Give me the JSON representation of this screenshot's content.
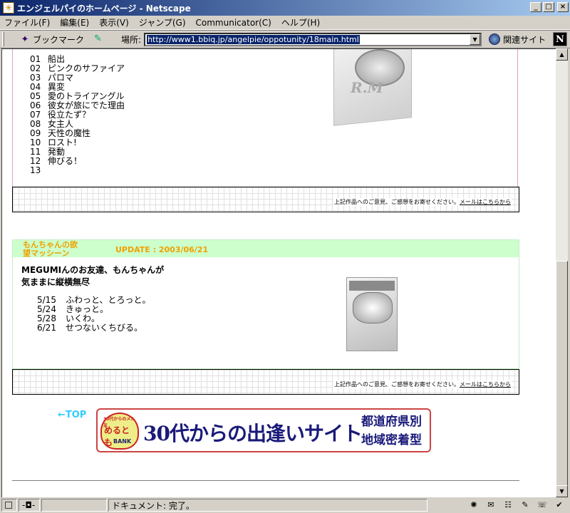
{
  "window": {
    "title": "エンジェルパイのホームページ - Netscape",
    "controls": {
      "minimize": "_",
      "maximize": "□",
      "close": "×"
    }
  },
  "menu": [
    "ファイル(F)",
    "編集(E)",
    "表示(V)",
    "ジャンプ(G)",
    "Communicator(C)",
    "ヘルプ(H)"
  ],
  "toolbar": {
    "bookmarks_label": "ブックマーク",
    "location_label": "場所:",
    "url": "http://www1.bbiq.jp/angelpie/oppotunity/18main.html",
    "related_label": "関連サイト",
    "logo": "N"
  },
  "section1": {
    "tracks": [
      {
        "num": "01",
        "title": "船出"
      },
      {
        "num": "02",
        "title": "ピンクのサファイア"
      },
      {
        "num": "03",
        "title": "パロマ"
      },
      {
        "num": "04",
        "title": "異変"
      },
      {
        "num": "05",
        "title": "愛のトライアングル"
      },
      {
        "num": "06",
        "title": "彼女が旅にでた理由"
      },
      {
        "num": "07",
        "title": "役立たず？"
      },
      {
        "num": "08",
        "title": "女主人"
      },
      {
        "num": "09",
        "title": "天性の魔性"
      },
      {
        "num": "10",
        "title": "ロスト!"
      },
      {
        "num": "11",
        "title": "発動"
      },
      {
        "num": "12",
        "title": "伸びる！"
      },
      {
        "num": "13",
        "title": ""
      }
    ],
    "package_text": "R.M",
    "feedback_text": "上記作品へのご意見、ご感想をお寄せください。",
    "feedback_link": "メールはこちらから"
  },
  "section2": {
    "title_line1": "もんちゃんの欲",
    "title_line2": "望マッシーン",
    "update": "UPDATE : 2003/06/21",
    "intro_line1": "MEGUMIんのお友達、もんちゃんが",
    "intro_line2": "気ままに縦横無尽",
    "songs": [
      {
        "date": "5/15",
        "title": "ふわっと、とろっと。"
      },
      {
        "date": "5/24",
        "title": "きゅっと。"
      },
      {
        "date": "5/28",
        "title": "いくわ。"
      },
      {
        "date": "6/21",
        "title": "せつないくちびる。"
      }
    ],
    "feedback_text": "上記作品へのご意見、ご感想をお寄せください。",
    "feedback_link": "メールはこちらから"
  },
  "footer": {
    "top_link": "←TOP",
    "banner": {
      "heart_top": "30代からのメル友",
      "heart_main": "めるとも",
      "heart_bank": "BANK",
      "main": "30代からの出逢いサイト",
      "side_line1": "都道府県別",
      "side_line2": "地域密着型"
    }
  },
  "statusbar": {
    "status_text": "ドキュメント: 完了。"
  }
}
